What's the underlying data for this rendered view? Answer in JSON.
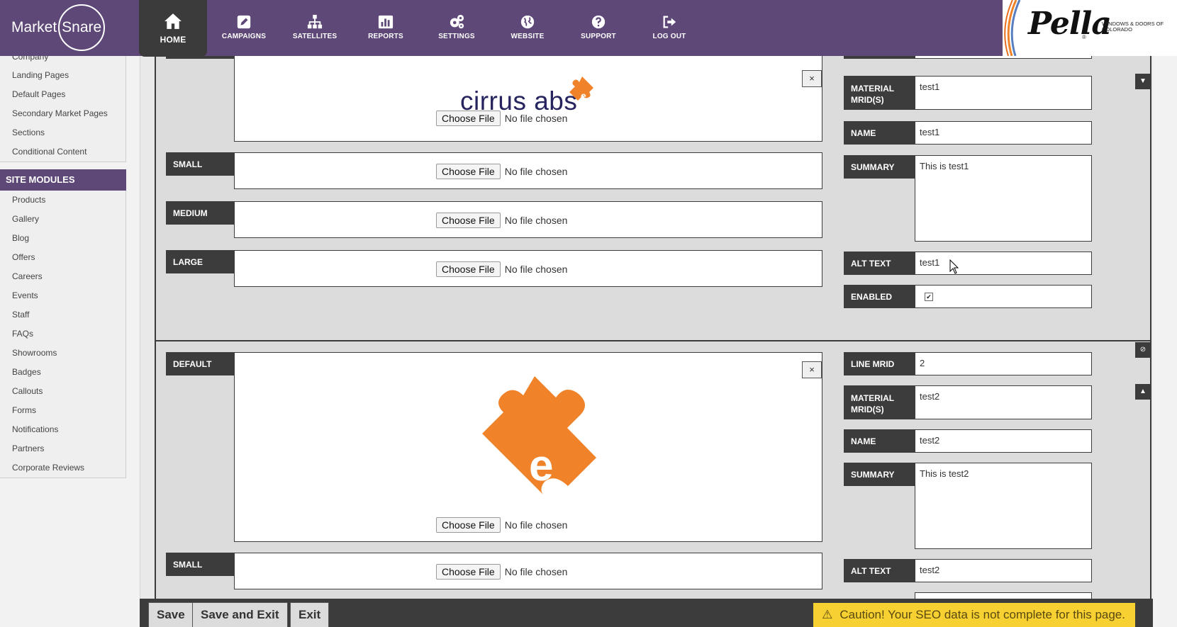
{
  "brand": {
    "market": "Market",
    "snare": "Snare"
  },
  "nav": [
    {
      "label": "HOME",
      "icon": "home-icon"
    },
    {
      "label": "CAMPAIGNS",
      "icon": "pencil-square-icon"
    },
    {
      "label": "SATELLITES",
      "icon": "sitemap-icon"
    },
    {
      "label": "REPORTS",
      "icon": "bar-chart-icon"
    },
    {
      "label": "SETTINGS",
      "icon": "gears-icon"
    },
    {
      "label": "WEBSITE",
      "icon": "globe-icon"
    },
    {
      "label": "SUPPORT",
      "icon": "question-circle-icon"
    },
    {
      "label": "LOG OUT",
      "icon": "sign-out-icon"
    }
  ],
  "client": {
    "name": "Pella",
    "reg": "®",
    "sub": "WINDOWS & DOORS OF COLORADO"
  },
  "sidebar": {
    "content_items": [
      "Company",
      "Landing Pages",
      "Default Pages",
      "Secondary Market Pages",
      "Sections",
      "Conditional Content"
    ],
    "modules_heading": "SITE MODULES",
    "module_items": [
      "Products",
      "Gallery",
      "Blog",
      "Offers",
      "Careers",
      "Events",
      "Staff",
      "FAQs",
      "Showrooms",
      "Badges",
      "Callouts",
      "Forms",
      "Notifications",
      "Partners",
      "Corporate Reviews"
    ]
  },
  "file_input": {
    "button": "Choose File",
    "status": "No file chosen"
  },
  "remove_glyph": "×",
  "block1": {
    "image_text": "cirrus abs",
    "labels": {
      "small": "SMALL",
      "medium": "MEDIUM",
      "large": "LARGE"
    },
    "fields": {
      "material_label": "MATERIAL MRID(S)",
      "material_value": "test1",
      "name_label": "NAME",
      "name_value": "test1",
      "summary_label": "SUMMARY",
      "summary_value": "This is test1",
      "alt_label": "ALT TEXT",
      "alt_value": "test1",
      "enabled_label": "ENABLED",
      "enabled_check": "✔"
    },
    "collapse_glyph": "▼"
  },
  "block2": {
    "labels": {
      "default": "DEFAULT",
      "small": "SMALL"
    },
    "fields": {
      "line_label": "LINE MRID",
      "line_value": "2",
      "material_label": "MATERIAL MRID(S)",
      "material_value": "test2",
      "name_label": "NAME",
      "name_value": "test2",
      "summary_label": "SUMMARY",
      "summary_value": "This is test2",
      "alt_label": "ALT TEXT",
      "alt_value": "test2"
    },
    "disable_glyph": "⊘",
    "expand_glyph": "▲"
  },
  "bottom": {
    "save": "Save",
    "save_exit": "Save and Exit",
    "exit": "Exit",
    "caution_icon": "⚠",
    "caution": "Caution! Your SEO data is not complete for this page."
  },
  "colors": {
    "brand_purple": "#5e4878",
    "dark": "#3c3c3c",
    "accent_orange": "#f0832a",
    "warning": "#f7d032"
  }
}
